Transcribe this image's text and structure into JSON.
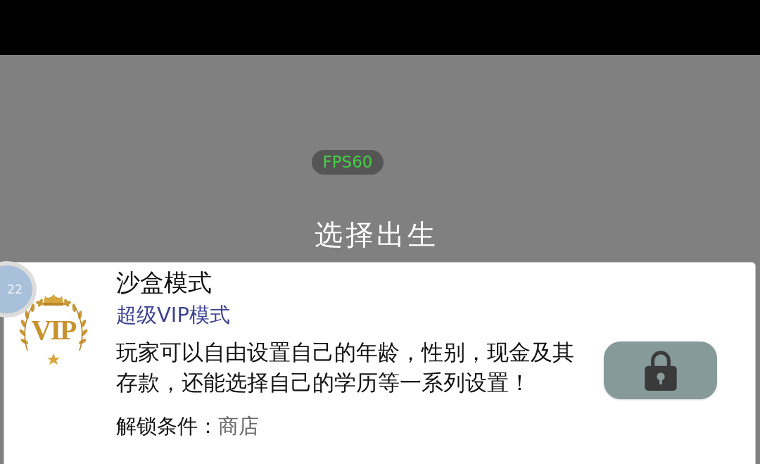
{
  "fps_badge": {
    "text": "FPS60"
  },
  "header": {
    "title": "选择出生"
  },
  "level_badge": {
    "text": "22"
  },
  "modes": [
    {
      "logo_text": "VIP",
      "title": "沙盒模式",
      "subtitle": "超级VIP模式",
      "description": "玩家可以自由设置自己的年龄，性别，现金及其存款，还能选择自己的学历等一系列设置！",
      "unlock_label": "解锁条件：",
      "unlock_value": "商店",
      "locked": true
    }
  ]
}
